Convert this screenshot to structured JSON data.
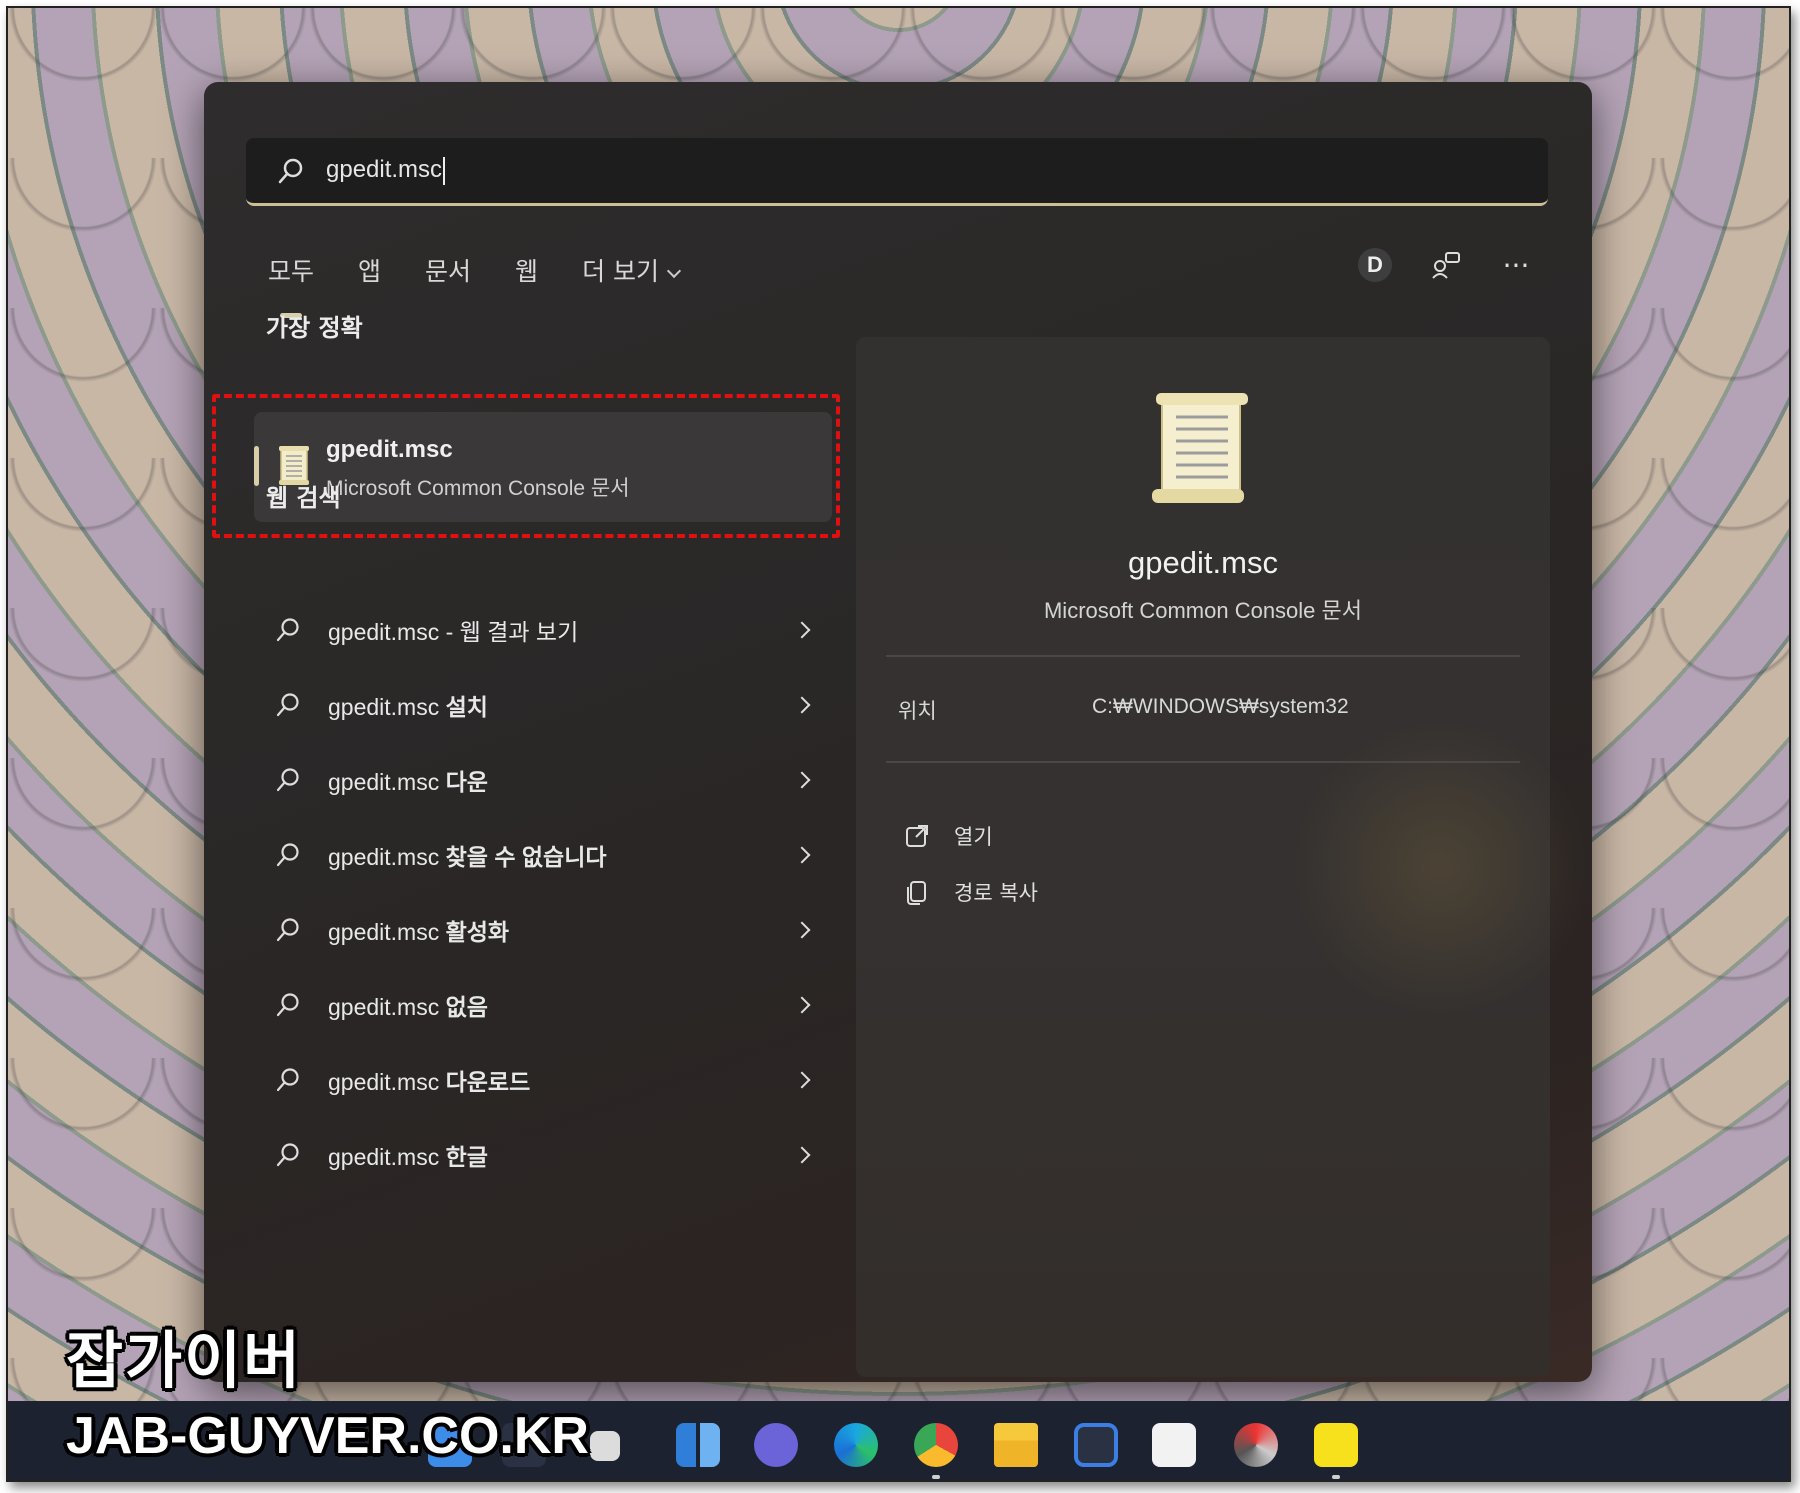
{
  "search": {
    "query": "gpedit.msc"
  },
  "tabs": [
    {
      "label": "모두",
      "active": true
    },
    {
      "label": "앱"
    },
    {
      "label": "문서"
    },
    {
      "label": "웹"
    },
    {
      "label": "더 보기"
    }
  ],
  "account": {
    "initial": "D"
  },
  "more_glyph": "···",
  "sections": {
    "best_match_title": "가장 정확",
    "web_search_title": "웹 검색"
  },
  "best_match": {
    "name": "gpedit.msc",
    "type": "Microsoft Common Console 문서"
  },
  "web_results": [
    {
      "query": "gpedit.msc",
      "suffix": " - 웹 결과 보기",
      "bold_suffix": false
    },
    {
      "query": "gpedit.msc ",
      "suffix": "설치",
      "bold_suffix": true
    },
    {
      "query": "gpedit.msc ",
      "suffix": "다운",
      "bold_suffix": true
    },
    {
      "query": "gpedit.msc ",
      "suffix": "찾을 수 없습니다",
      "bold_suffix": true
    },
    {
      "query": "gpedit.msc ",
      "suffix": "활성화",
      "bold_suffix": true
    },
    {
      "query": "gpedit.msc ",
      "suffix": "없음",
      "bold_suffix": true
    },
    {
      "query": "gpedit.msc ",
      "suffix": "다운로드",
      "bold_suffix": true
    },
    {
      "query": "gpedit.msc ",
      "suffix": "한글",
      "bold_suffix": true
    }
  ],
  "preview": {
    "name": "gpedit.msc",
    "type": "Microsoft Common Console 문서",
    "location_label": "위치",
    "location_value": "C:₩WINDOWS₩system32",
    "actions": [
      {
        "label": "열기",
        "icon": "open-external-icon"
      },
      {
        "label": "경로 복사",
        "icon": "copy-icon"
      }
    ]
  },
  "taskbar": {
    "apps": [
      "windows-start-icon",
      "search-icon",
      "task-view-icon",
      "widgets-icon",
      "teams-chat-icon",
      "edge-icon",
      "chrome-icon",
      "file-explorer-icon",
      "dev-tool-icon",
      "store-icon",
      "app-icon",
      "kakaotalk-icon"
    ]
  },
  "watermark": {
    "korean": "잡가이버",
    "english": "JAB-GUYVER.CO.KR"
  },
  "colors": {
    "accent_underline": "#cdbf95",
    "highlight_box": "#e01010"
  }
}
